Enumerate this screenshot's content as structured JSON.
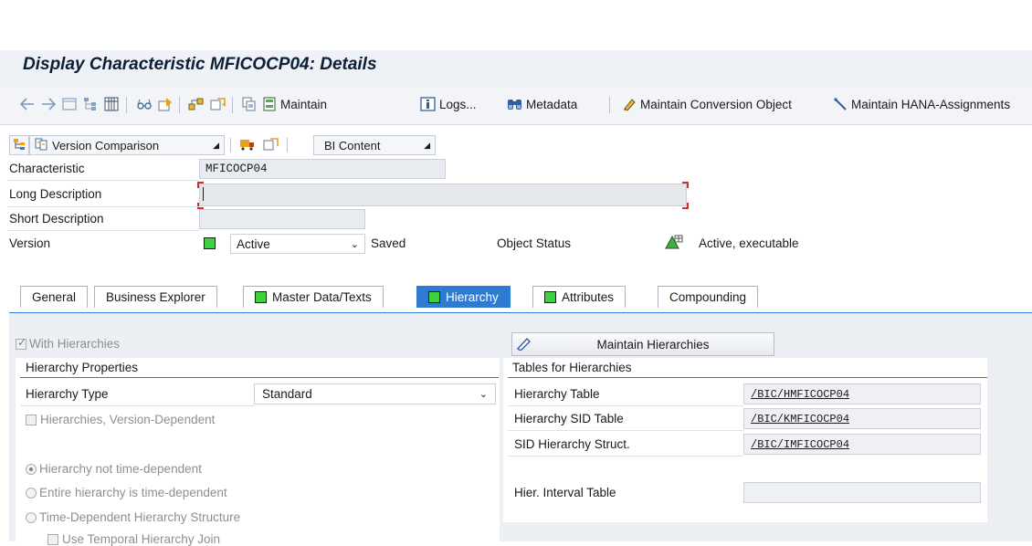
{
  "window": {
    "title": "Display Characteristic MFICOCP04: Details"
  },
  "toolbar": {
    "maintain_label": "Maintain",
    "logs_label": "Logs...",
    "metadata_label": "Metadata",
    "maintain_conversion_label": "Maintain Conversion Object",
    "maintain_hana_label": "Maintain HANA-Assignments"
  },
  "header_toolbar": {
    "version_comparison_label": "Version Comparison",
    "bi_content_label": "BI Content"
  },
  "header": {
    "characteristic_label": "Characteristic",
    "characteristic_value": "MFICOCP04",
    "long_description_label": "Long Description",
    "long_description_value": "",
    "short_description_label": "Short Description",
    "short_description_value": "",
    "version_label": "Version",
    "version_value": "Active",
    "saved_label": "Saved",
    "object_status_label": "Object Status",
    "object_status_value": "Active, executable"
  },
  "tabs": [
    {
      "label": "General",
      "active": false
    },
    {
      "label": "Business Explorer",
      "active": false
    },
    {
      "label": "Master Data/Texts",
      "active": false
    },
    {
      "label": "Hierarchy",
      "active": true
    },
    {
      "label": "Attributes",
      "active": false
    },
    {
      "label": "Compounding",
      "active": false
    }
  ],
  "hierarchy_tab": {
    "with_hierarchies_label": "With Hierarchies",
    "with_hierarchies_checked": true,
    "maintain_hierarchies_label": "Maintain Hierarchies",
    "properties_group_title": "Hierarchy Properties",
    "hierarchy_type_label": "Hierarchy Type",
    "hierarchy_type_value": "Standard",
    "version_dependent_label": "Hierarchies, Version-Dependent",
    "radio_not_time_dependent": "Hierarchy not time-dependent",
    "radio_entire_time_dependent": "Entire hierarchy is time-dependent",
    "radio_time_dependent_structure": "Time-Dependent Hierarchy Structure",
    "use_temporal_join_label": "Use Temporal Hierarchy Join",
    "tables_group_title": "Tables for Hierarchies",
    "hierarchy_table_label": "Hierarchy Table",
    "hierarchy_table_value": "/BIC/HMFICOCP04",
    "hierarchy_sid_table_label": "Hierarchy SID Table",
    "hierarchy_sid_table_value": "/BIC/KMFICOCP04",
    "sid_hierarchy_struct_label": "SID Hierarchy Struct.",
    "sid_hierarchy_struct_value": "/BIC/IMFICOCP04",
    "hier_interval_table_label": "Hier. Interval Table",
    "hier_interval_table_value": ""
  },
  "colors": {
    "accent": "#2f7bd2",
    "status_green": "#3fd13f",
    "title_text": "#0b1f36"
  }
}
